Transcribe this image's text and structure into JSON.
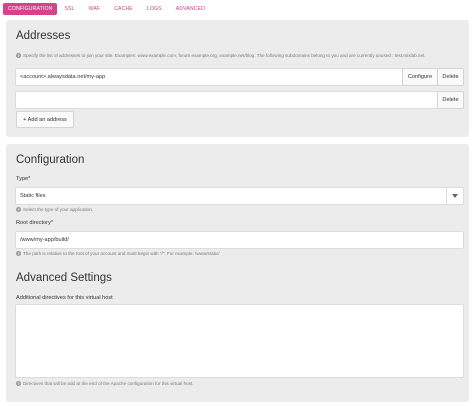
{
  "tabs": [
    {
      "label": "Configuration",
      "active": true
    },
    {
      "label": "SSL",
      "active": false
    },
    {
      "label": "WAF",
      "active": false
    },
    {
      "label": "Cache",
      "active": false
    },
    {
      "label": "Logs",
      "active": false
    },
    {
      "label": "Advanced",
      "active": false
    }
  ],
  "addresses": {
    "title": "Addresses",
    "help": "Specify the list of addresses to join your site. Examples: www.example.com, forum.example.org, example.net/blog. The following subdomains belong to you and are currently unused : test.mixlab.net.",
    "rows": [
      {
        "value": "<account>.alwaysdata.net/my-app",
        "configure_label": "Configure",
        "delete_label": "Delete"
      },
      {
        "value": "",
        "delete_label": "Delete"
      }
    ],
    "add_label": "+ Add an address"
  },
  "configuration": {
    "title": "Configuration",
    "type_label": "Type*",
    "type_value": "Static files",
    "type_help": "Select the type of your application.",
    "root_label": "Root directory*",
    "root_value": "/www/my-app/build/",
    "root_help": "The path is relative to the root of your account and must begin with \"/\". For example: /www/static/"
  },
  "advanced": {
    "title": "Advanced Settings",
    "directives_label": "Additional directives for this virtual host",
    "directives_value": "",
    "directives_help": "Directives that will be add at the end of the Apache configuration for this virtual host."
  },
  "colors": {
    "accent": "#d9418a",
    "panel": "#ececec"
  }
}
